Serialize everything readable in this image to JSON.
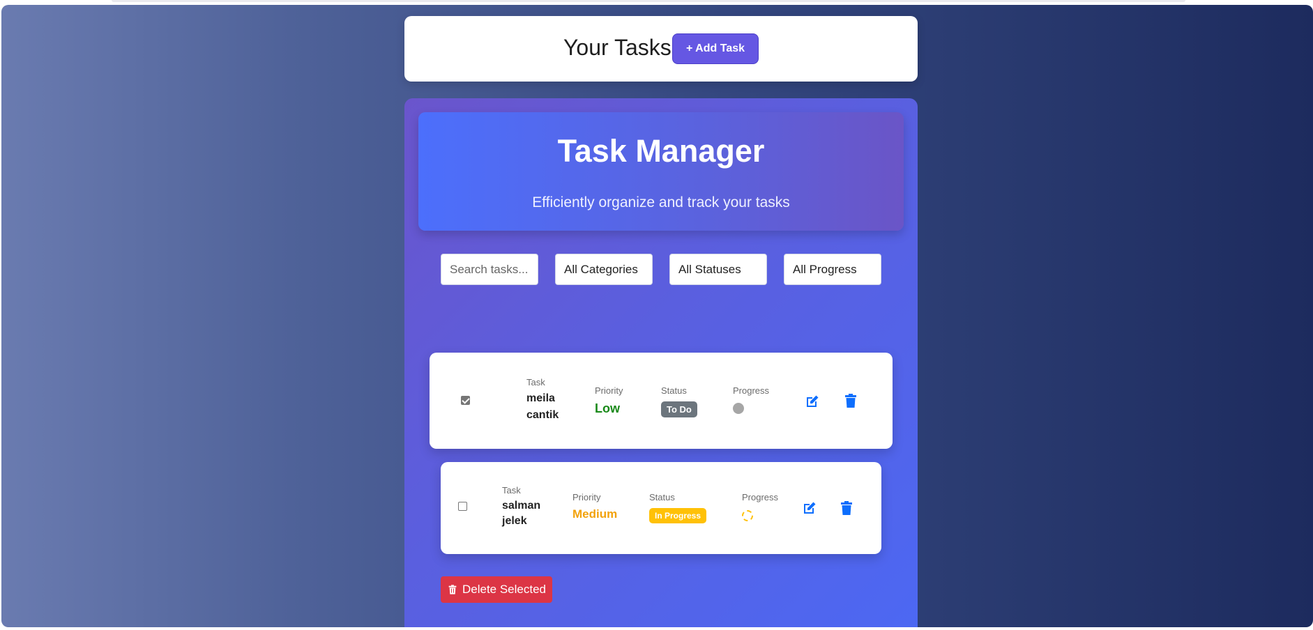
{
  "header": {
    "title": "Your Tasks",
    "add_button_label": "+ Add Task"
  },
  "hero": {
    "title": "Task Manager",
    "subtitle": "Efficiently organize and track your tasks"
  },
  "filters": {
    "search_placeholder": "Search tasks...",
    "category_selected": "All Categories",
    "status_selected": "All Statuses",
    "progress_selected": "All Progress"
  },
  "columns": {
    "task": "Task",
    "priority": "Priority",
    "status": "Status",
    "progress": "Progress"
  },
  "tasks": [
    {
      "checked": true,
      "name": "meila cantik",
      "priority": "Low",
      "priority_color": "#1a8a1a",
      "status": "To Do",
      "status_color": "#6c757d",
      "progress_icon": "gray-dot-icon"
    },
    {
      "checked": false,
      "name": "salman jelek",
      "priority": "Medium",
      "priority_color": "#f2a20c",
      "status": "In Progress",
      "status_color": "#ffc107",
      "progress_icon": "yellow-ring-icon"
    }
  ],
  "actions": {
    "delete_selected_label": "Delete Selected"
  },
  "colors": {
    "accent": "#6557e3",
    "action_icon": "#0d6efd",
    "danger": "#dc3545"
  }
}
